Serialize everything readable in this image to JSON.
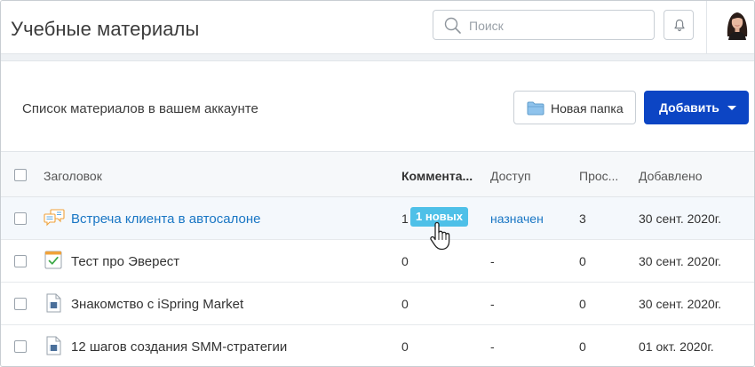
{
  "header": {
    "title": "Учебные материалы",
    "search_placeholder": "Поиск",
    "search_icon": "search-icon",
    "notifications_icon": "bell-icon"
  },
  "toolbar": {
    "description": "Список материалов в вашем аккаунте",
    "new_folder_label": "Новая папка",
    "add_label": "Добавить"
  },
  "table": {
    "columns": [
      "Заголовок",
      "Коммента...",
      "Доступ",
      "Прос...",
      "Добавлено"
    ],
    "rows": [
      {
        "icon": "conversation-icon",
        "title": "Встреча клиента в автосалоне",
        "comments": "1",
        "comments_badge": "1 новых",
        "access": "назначен",
        "views": "3",
        "added": "30 сент. 2020г."
      },
      {
        "icon": "quiz-icon",
        "title": "Тест про Эверест",
        "comments": "0",
        "access": "-",
        "views": "0",
        "added": "30 сент. 2020г."
      },
      {
        "icon": "video-document-icon",
        "title": "Знакомство с iSpring Market",
        "comments": "0",
        "access": "-",
        "views": "0",
        "added": "30 сент. 2020г."
      },
      {
        "icon": "video-document-icon",
        "title": "12 шагов создания SMM-стратегии",
        "comments": "0",
        "access": "-",
        "views": "0",
        "added": "01 окт. 2020г."
      }
    ]
  },
  "colors": {
    "primary_button": "#0c45c4",
    "link": "#1976c4",
    "badge": "#4ec0e8"
  }
}
